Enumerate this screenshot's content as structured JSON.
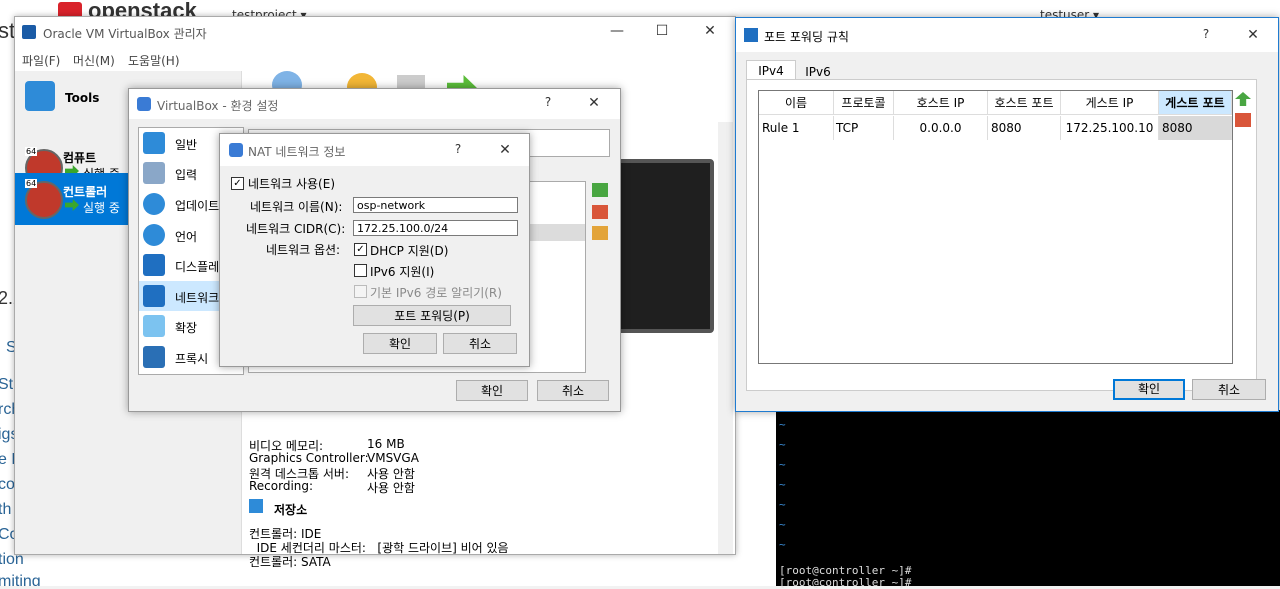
{
  "browser": {
    "logo_text": "openstack",
    "project": "testproject ▾",
    "user": "testuser ▾",
    "left_fragments": [
      "st",
      "2.2",
      "S",
      "St",
      "rch",
      "igs",
      "e F",
      "co",
      "th",
      "Co",
      "tion",
      "miting"
    ]
  },
  "terminal": {
    "lines": [
      "[root@controller ~]#",
      "[root@controller ~]#"
    ]
  },
  "vbox_manager": {
    "title": "Oracle VM VirtualBox 관리자",
    "menu": [
      "파일(F)",
      "머신(M)",
      "도움말(H)"
    ],
    "sidebar": {
      "tools_label": "Tools",
      "vms": [
        {
          "name": "컴퓨트",
          "status": "실행 중",
          "badge": "64"
        },
        {
          "name": "컨트롤러",
          "status": "실행 중",
          "badge": "64"
        }
      ]
    },
    "details": {
      "display": [
        {
          "k": "비디오 메모리:",
          "v": "16 MB"
        },
        {
          "k": "Graphics Controller:",
          "v": "VMSVGA"
        },
        {
          "k": "원격 데스크톱 서버:",
          "v": "사용 안함"
        },
        {
          "k": "Recording:",
          "v": "사용 안함"
        }
      ],
      "storage_title": "저장소",
      "storage_lines": [
        "컨트롤러: IDE",
        "  IDE 세컨더리 마스터:   [광학 드라이브] 비어 있음",
        "컨트롤러: SATA"
      ]
    }
  },
  "prefs": {
    "title": "VirtualBox - 환경 설정",
    "items": [
      "일반",
      "입력",
      "업데이트",
      "언어",
      "디스플레이",
      "네트워크",
      "확장",
      "프록시"
    ],
    "ok_label": "확인",
    "cancel_label": "취소"
  },
  "nat": {
    "title": "NAT 네트워크 정보",
    "enable_label": "네트워크 사용(E)",
    "name_label": "네트워크 이름(N):",
    "name_value": "osp-network",
    "cidr_label": "네트워크 CIDR(C):",
    "cidr_value": "172.25.100.0/24",
    "options_label": "네트워크 옵션:",
    "dhcp_label": "DHCP 지원(D)",
    "ipv6_label": "IPv6 지원(I)",
    "ipv6_route_label": "기본 IPv6 경로 알리기(R)",
    "port_forward_label": "포트 포워딩(P)",
    "ok_label": "확인",
    "cancel_label": "취소"
  },
  "port_forwarding": {
    "title": "포트 포워딩 규칙",
    "tabs": [
      "IPv4",
      "IPv6"
    ],
    "headers": [
      "이름",
      "프로토콜",
      "호스트 IP",
      "호스트 포트",
      "게스트 IP",
      "게스트 포트"
    ],
    "rows": [
      {
        "name": "Rule 1",
        "protocol": "TCP",
        "host_ip": "0.0.0.0",
        "host_port": "8080",
        "guest_ip": "172.25.100.10",
        "guest_port": "8080"
      }
    ],
    "ok_label": "확인",
    "cancel_label": "취소"
  }
}
